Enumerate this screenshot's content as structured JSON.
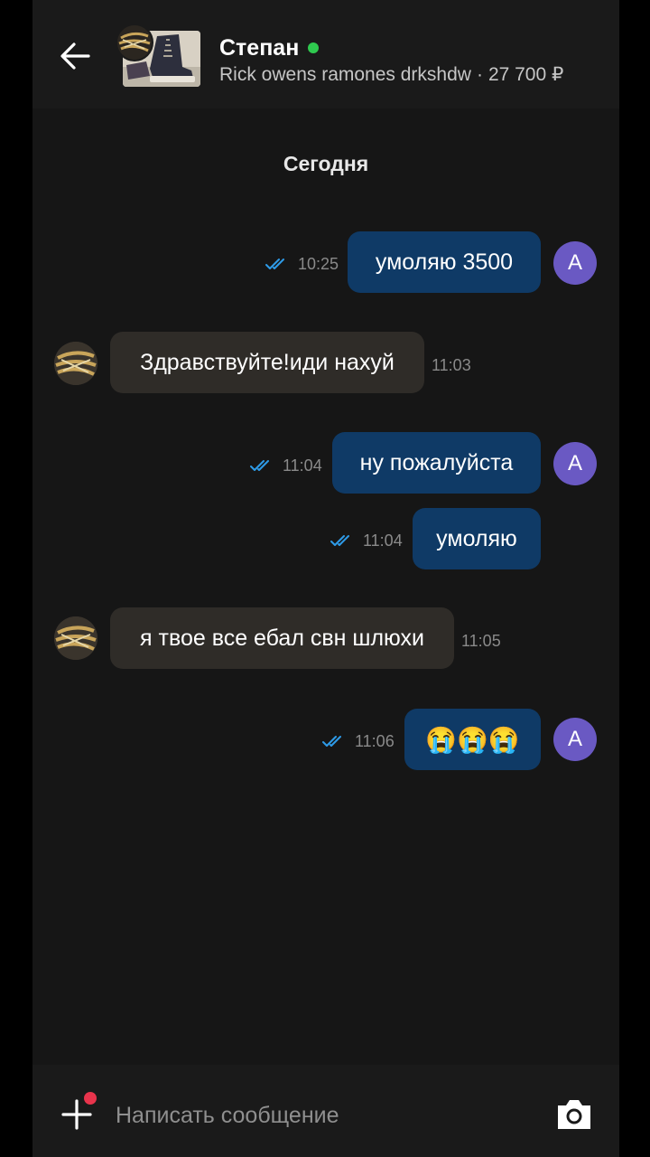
{
  "header": {
    "contact_name": "Степан",
    "item_title": "Rick owens ramones drkshdw",
    "separator": "·",
    "price": "27 700 ₽",
    "online_color": "#2fc94f"
  },
  "chat": {
    "date_label": "Сегодня",
    "messages": [
      {
        "direction": "out",
        "text": "умоляю 3500",
        "time": "10:25",
        "status": "read",
        "avatar_letter": "А"
      },
      {
        "direction": "in",
        "text": "Здравствуйте!иди нахуй",
        "time": "11:03"
      },
      {
        "direction": "out",
        "text": "ну пожалуйста",
        "time": "11:04",
        "status": "read",
        "avatar_letter": "А"
      },
      {
        "direction": "out",
        "text": "умоляю",
        "time": "11:04",
        "status": "read"
      },
      {
        "direction": "in",
        "text": "я твое все ебал свн шлюхи",
        "time": "11:05"
      },
      {
        "direction": "out",
        "text": "😭😭😭",
        "time": "11:06",
        "status": "read",
        "avatar_letter": "А"
      }
    ]
  },
  "composer": {
    "placeholder": "Написать сообщение",
    "value": ""
  },
  "icons": {
    "back": "arrow-left-icon",
    "read_status": "double-check-icon",
    "attach": "plus-icon",
    "camera": "camera-icon"
  },
  "colors": {
    "outgoing_bubble": "#0f3a66",
    "incoming_bubble": "#2f2c28",
    "avatar_bg": "#6a59c3",
    "check_color": "#2e9be8",
    "notification_dot": "#e8344c"
  }
}
